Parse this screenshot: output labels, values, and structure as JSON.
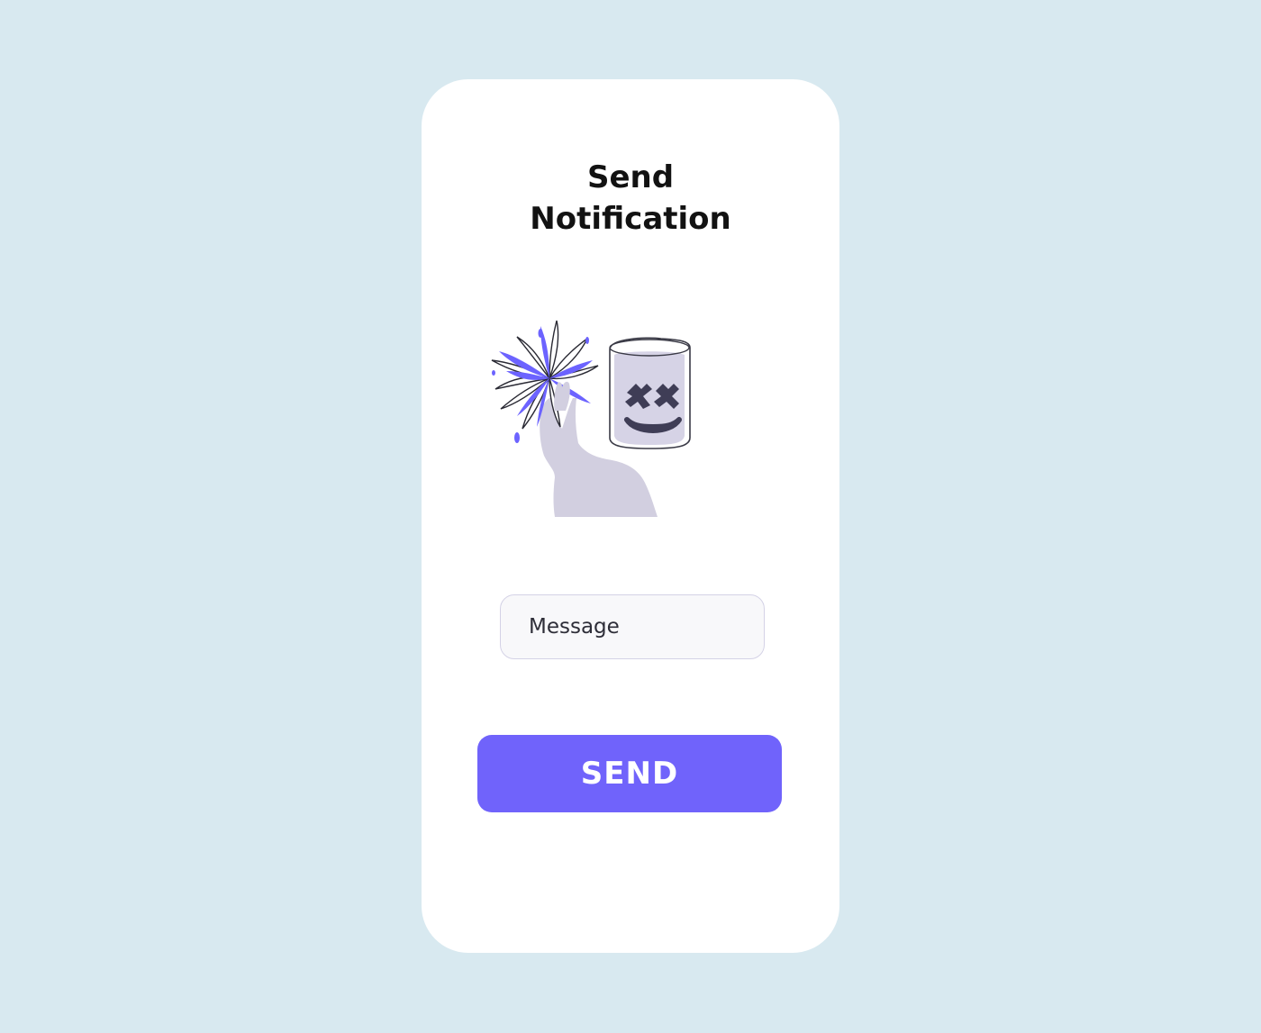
{
  "screen": {
    "title_line1": "Send",
    "title_line2": "Notification"
  },
  "illustration": {
    "subject": "marshmello-mask-fireworks-illustration",
    "colors": {
      "accent": "#6c63ff",
      "figure": "#d2cfe0",
      "face": "#3f3d56"
    }
  },
  "message_input": {
    "placeholder": "Message",
    "value": ""
  },
  "send_button": {
    "label": "SEND"
  },
  "colors": {
    "background": "#d8e9f0",
    "card": "#ffffff",
    "primary": "#7063fb",
    "title_text": "#121212",
    "input_border": "#d4d2e6",
    "input_background": "#f8f8fa"
  }
}
